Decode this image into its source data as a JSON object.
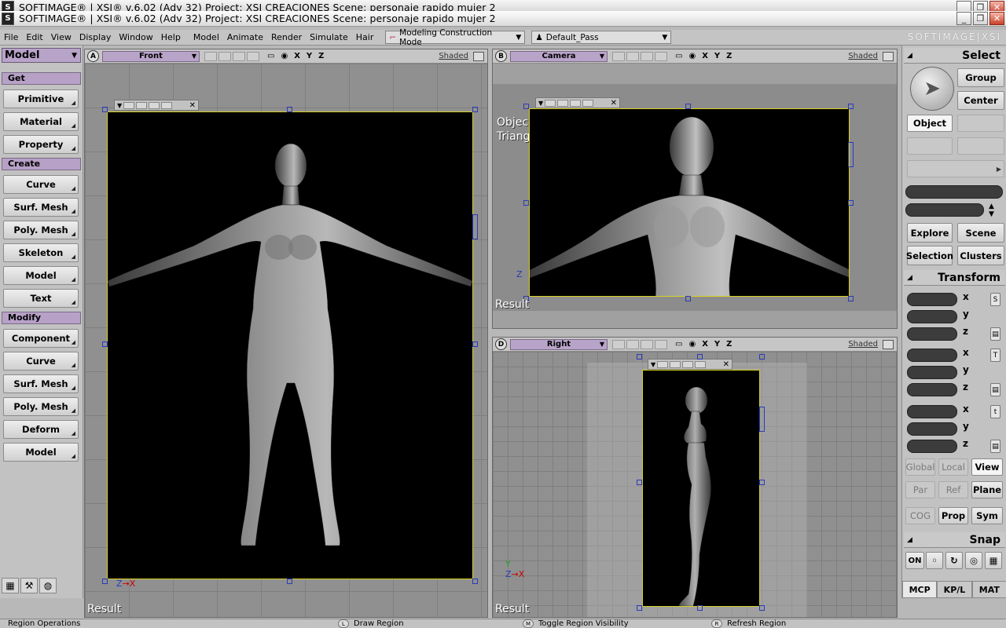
{
  "title_bars": {
    "back": "SOFTIMAGE® | XSI® v.6.02 (Adv 32) Project: XSI CREACIONES     Scene: personaje rapido mujer 2",
    "front": "SOFTIMAGE® | XSI® v.6.02 (Adv 32) Project: XSI CREACIONES     Scene: personaje rapido mujer 2"
  },
  "window_buttons": {
    "minimize": "_",
    "restore": "❐",
    "close": "✕"
  },
  "menu": [
    "File",
    "Edit",
    "View",
    "Display",
    "Window",
    "Help",
    "Model",
    "Animate",
    "Render",
    "Simulate",
    "Hair"
  ],
  "mode_combo": "Modeling Construction Mode",
  "pass_combo": "Default_Pass",
  "brand": "SOFTIMAGE|XSI",
  "left_panel": {
    "module": "Model",
    "sections": [
      {
        "title": "Get",
        "buttons": [
          "Primitive",
          "Material",
          "Property"
        ]
      },
      {
        "title": "Create",
        "buttons": [
          "Curve",
          "Surf. Mesh",
          "Poly. Mesh",
          "Skeleton",
          "Model",
          "Text"
        ]
      },
      {
        "title": "Modify",
        "buttons": [
          "Component",
          "Curve",
          "Surf. Mesh",
          "Poly. Mesh",
          "Deform",
          "Model"
        ]
      }
    ]
  },
  "viewports": {
    "a": {
      "letter": "A",
      "camera": "Front",
      "axes": [
        "X",
        "Y",
        "Z"
      ],
      "mode": "Shaded",
      "result": "Result"
    },
    "b": {
      "letter": "B",
      "camera": "Camera",
      "axes": [
        "X",
        "Y",
        "Z"
      ],
      "mode": "Shaded",
      "result": "Result",
      "overlay_line1": "Objec",
      "overlay_line2": "Triang"
    },
    "d": {
      "letter": "D",
      "camera": "Right",
      "axes": [
        "X",
        "Y",
        "Z"
      ],
      "mode": "Shaded",
      "result": "Result"
    }
  },
  "right_panel": {
    "select": {
      "title": "Select",
      "group": "Group",
      "center": "Center",
      "object": "Object",
      "explore": "Explore",
      "scene": "Scene",
      "selection": "Selection",
      "clusters": "Clusters"
    },
    "transform": {
      "title": "Transform",
      "axes": [
        "x",
        "y",
        "z"
      ],
      "global": "Global",
      "local": "Local",
      "view": "View",
      "par": "Par",
      "ref": "Ref",
      "plane": "Plane",
      "cog": "COG",
      "prop": "Prop",
      "sym": "Sym",
      "scale_glyph": "S",
      "rotate_glyph": "T",
      "translate_glyph": "t"
    },
    "snap": {
      "title": "Snap",
      "on": "ON"
    },
    "tabs": [
      "MCP",
      "KP/L",
      "MAT"
    ]
  },
  "status_bar": {
    "left": "Region Operations",
    "items": [
      {
        "key": "L",
        "label": "Draw Region"
      },
      {
        "key": "M",
        "label": "Toggle Region Visibility"
      },
      {
        "key": "R",
        "label": "Refresh Region"
      }
    ]
  },
  "colors": {
    "accent_purple": "#b8a3c9",
    "render_border": "#d8d020",
    "handle": "#2a3ab8"
  }
}
